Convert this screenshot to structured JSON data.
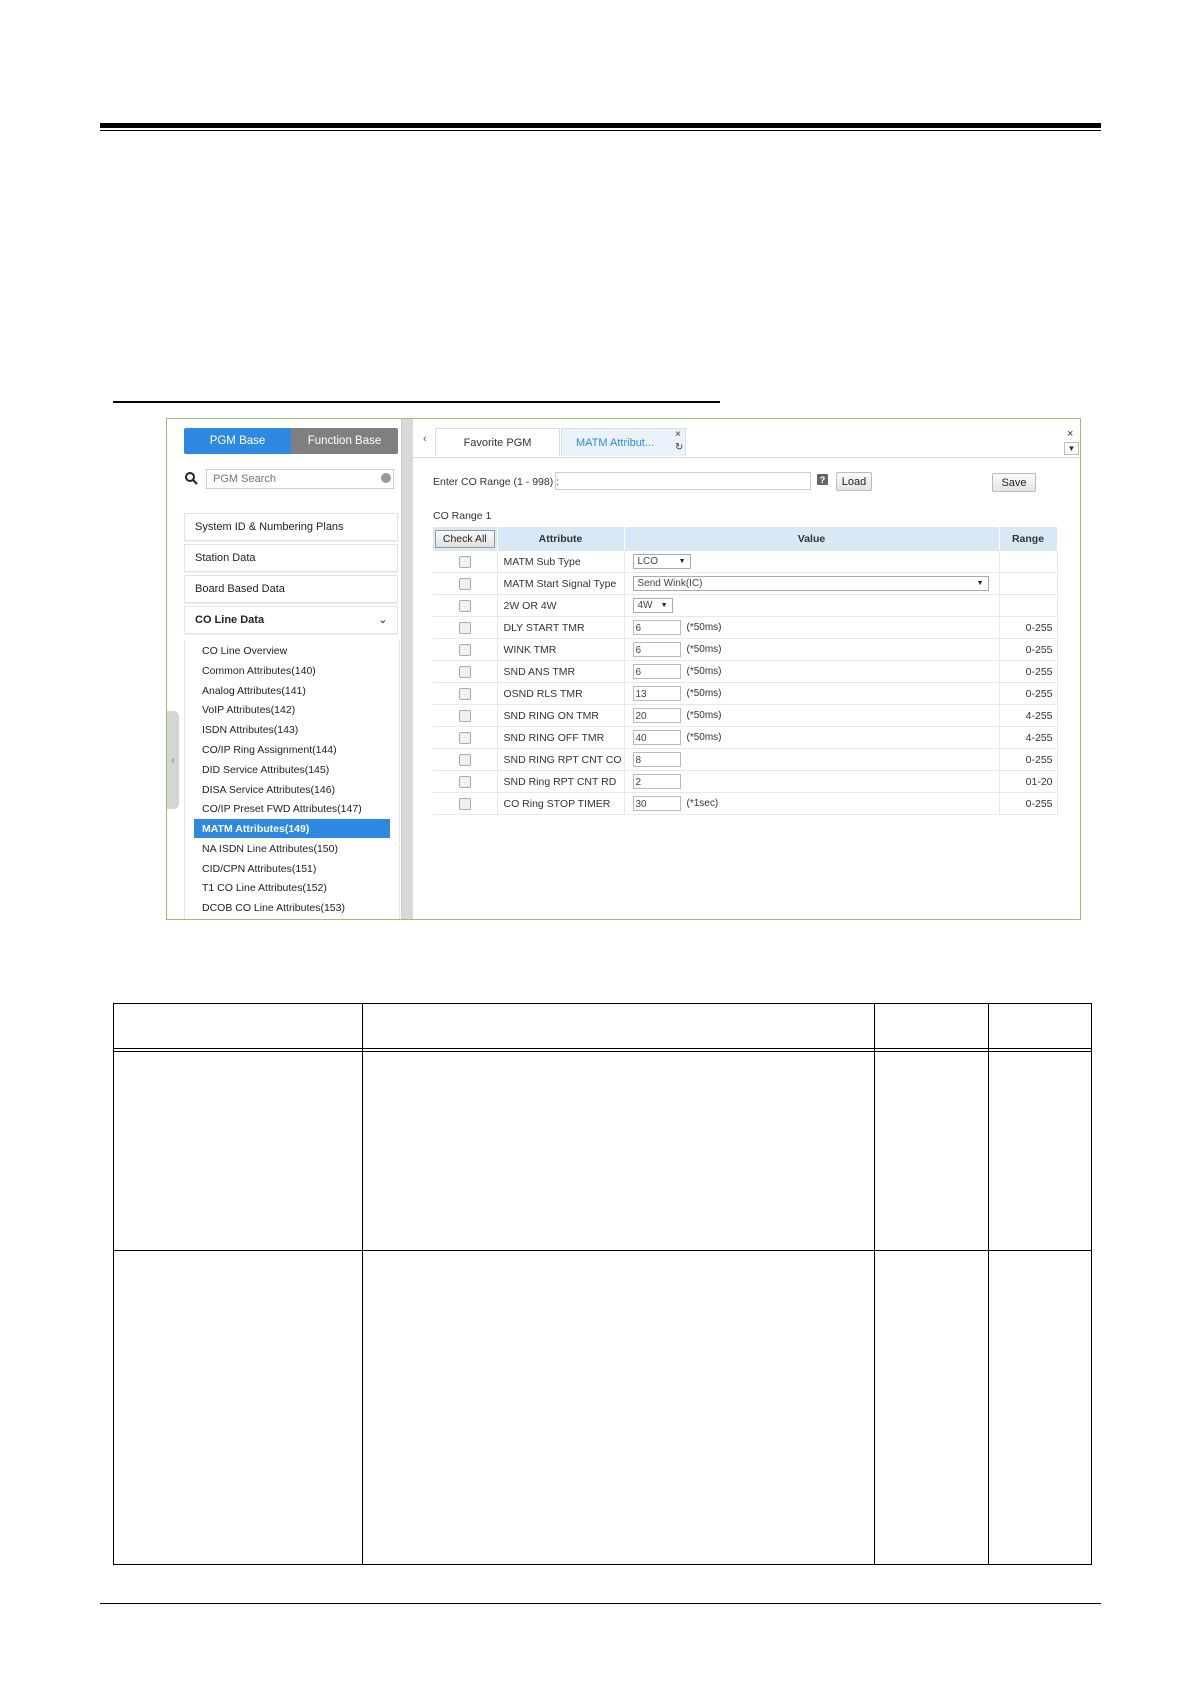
{
  "left_panel": {
    "segments": [
      "PGM Base",
      "Function Base"
    ],
    "search_placeholder": "PGM Search",
    "menu": [
      "System ID & Numbering Plans",
      "Station Data",
      "Board Based Data",
      "CO Line Data"
    ],
    "sub_items": [
      "CO Line Overview",
      "Common Attributes(140)",
      "Analog Attributes(141)",
      "VoIP Attributes(142)",
      "ISDN Attributes(143)",
      "CO/IP Ring Assignment(144)",
      "DID Service Attributes(145)",
      "DISA Service Attributes(146)",
      "CO/IP Preset FWD Attributes(147)",
      "MATM Attributes(149)",
      "NA ISDN Line Attributes(150)",
      "CID/CPN Attributes(151)",
      "T1 CO Line Attributes(152)",
      "DCOB CO Line Attributes(153)"
    ],
    "selected_item": "MATM Attributes(149)"
  },
  "tabs": {
    "favorite": "Favorite PGM",
    "active": "MATM Attribut...",
    "close_glyph": "×",
    "refresh_glyph": "↻"
  },
  "toolbar": {
    "range_label": "Enter CO Range (1 - 998) :",
    "help_glyph": "?",
    "load_label": "Load",
    "save_label": "Save",
    "co_range_caption": "CO Range 1"
  },
  "table": {
    "headers": {
      "check_all": "Check All",
      "attribute": "Attribute",
      "value": "Value",
      "range": "Range"
    },
    "rows": [
      {
        "attribute": "MATM Sub Type",
        "value": "LCO",
        "unit": "",
        "range": ""
      },
      {
        "attribute": "MATM Start Signal Type",
        "value": "Send Wink(IC)",
        "unit": "",
        "range": ""
      },
      {
        "attribute": "2W OR 4W",
        "value": "4W",
        "unit": "",
        "range": ""
      },
      {
        "attribute": "DLY START TMR",
        "value": "6",
        "unit": "(*50ms)",
        "range": "0-255"
      },
      {
        "attribute": "WINK TMR",
        "value": "6",
        "unit": "(*50ms)",
        "range": "0-255"
      },
      {
        "attribute": "SND ANS TMR",
        "value": "6",
        "unit": "(*50ms)",
        "range": "0-255"
      },
      {
        "attribute": "OSND RLS TMR",
        "value": "13",
        "unit": "(*50ms)",
        "range": "0-255"
      },
      {
        "attribute": "SND RING ON TMR",
        "value": "20",
        "unit": "(*50ms)",
        "range": "4-255"
      },
      {
        "attribute": "SND RING OFF TMR",
        "value": "40",
        "unit": "(*50ms)",
        "range": "4-255"
      },
      {
        "attribute": "SND RING RPT CNT CO",
        "value": "8",
        "unit": "",
        "range": "0-255"
      },
      {
        "attribute": "SND Ring RPT CNT RD",
        "value": "2",
        "unit": "",
        "range": "01-20"
      },
      {
        "attribute": "CO Ring STOP TIMER",
        "value": "30",
        "unit": "(*1sec)",
        "range": "0-255"
      }
    ]
  },
  "colors": {
    "accent": "#2d8ae0",
    "frame": "#8dc86b",
    "header_bg": "#d8e8f5"
  }
}
